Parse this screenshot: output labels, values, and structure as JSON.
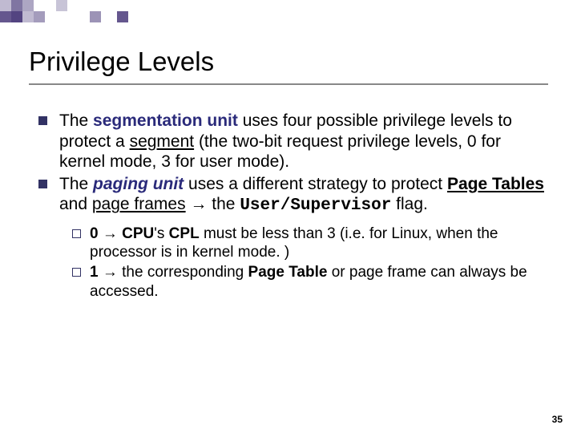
{
  "title": "Privilege Levels",
  "bullet1": {
    "pre": "The ",
    "seg_unit": "segmentation unit",
    "mid1": " uses four possible privilege levels to protect a ",
    "segment": "segment",
    "post": " (the two-bit request privilege levels, 0 for kernel mode, 3 for user mode)."
  },
  "bullet2": {
    "pre": "The ",
    "paging_unit": "paging unit",
    "mid1": " uses a different strategy to protect ",
    "page_tables": "Page Tables",
    "mid2": " and ",
    "page_frames": "page frames",
    "arrow": " → the ",
    "usr_sup": "User/Supervisor",
    "post": " flag."
  },
  "sub1": {
    "zero": "0",
    "arrow": " → ",
    "cpu": "CPU",
    "s": "'s ",
    "cpl": "CPL",
    "rest": " must be less than 3 (i.e. for Linux, when the processor is in kernel mode. )"
  },
  "sub2": {
    "one": "1",
    "arrow": " → the corresponding ",
    "page_table": "Page Table",
    "rest": " or page frame can always be accessed."
  },
  "page_number": "35"
}
